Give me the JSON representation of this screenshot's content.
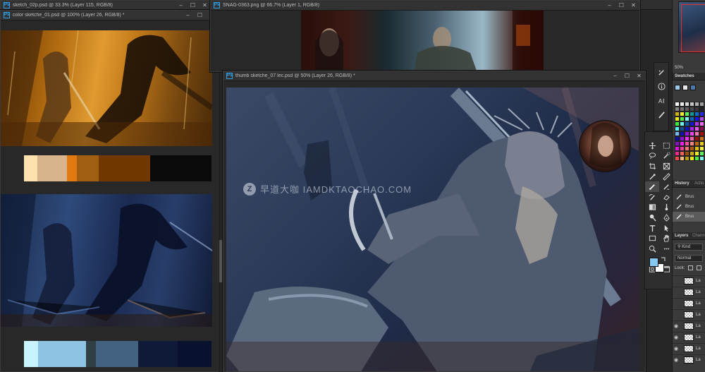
{
  "windows": {
    "sketch02": {
      "title": "sketch_02p.psd @ 33.3% (Layer 115, RGB/8)"
    },
    "color01": {
      "title": "color sketche_01.psd @ 100% (Layer 26, RGB/8) *"
    },
    "snag": {
      "title": "SNAG-0363.png @ 66.7% (Layer 1, RGB/8)"
    },
    "thumb07": {
      "title": "thumb sketche_07 lec.psd @ 50% (Layer 26, RGB/8) *"
    }
  },
  "watermark": {
    "logo_letter": "Z",
    "text": "早道大咖  IAMDKTAOCHAO.COM"
  },
  "palettes": {
    "warm": [
      "#fde2b0",
      "#d7b48c",
      "#e07a10",
      "#a05e10",
      "#703800",
      "#0a0a0a"
    ],
    "cool": [
      "#c8f4ff",
      "#8ec3e4",
      "#2f3f44",
      "#43627f",
      "#0f1a38",
      "#08122e"
    ]
  },
  "panels": {
    "zoom": "50%",
    "swatches_tab": "Swatches",
    "history_tab": "History",
    "actions_tab": "Actio",
    "history_items": [
      "Brus",
      "Brus",
      "Brus"
    ],
    "layers_tab": "Layers",
    "channels_tab": "Chann",
    "kind_placeholder": "Kind",
    "blend_mode": "Normal",
    "lock_label": "Lock:",
    "layer_names": [
      "La",
      "La",
      "La",
      "La",
      "La",
      "La",
      "La",
      "La"
    ]
  },
  "colors": {
    "foreground": "#86c8f0",
    "background": "#ffffff",
    "accent": "#2fa0e8"
  },
  "window_buttons": {
    "minimize": "–",
    "maximize": "☐",
    "close": "✕"
  }
}
